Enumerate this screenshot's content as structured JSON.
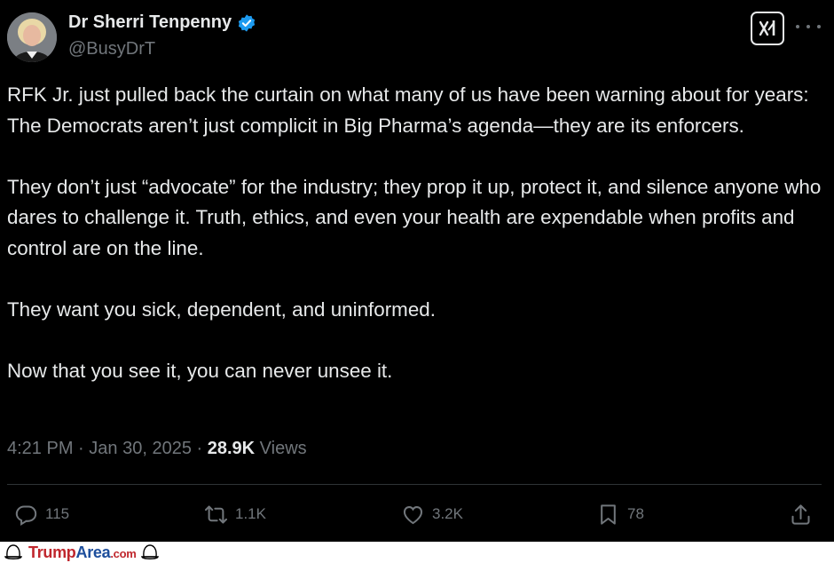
{
  "author": {
    "display_name": "Dr Sherri Tenpenny",
    "handle": "@BusyDrT",
    "verified": true
  },
  "tweet": {
    "paragraphs": [
      "RFK Jr. just pulled back the curtain on what many of us have been warning about for years: The Democrats aren’t just complicit in Big Pharma’s agenda—they are its enforcers.",
      "They don’t just “advocate” for the industry; they prop it up, protect it, and silence anyone who dares to challenge it. Truth, ethics, and even your health are expendable when profits and control are on the line.",
      "They want you sick, dependent, and uninformed.",
      "Now that you see it, you can never unsee it."
    ],
    "time": "4:21 PM",
    "date": "Jan 30, 2025",
    "separator": "·",
    "views_count": "28.9K",
    "views_label": "Views"
  },
  "actions": {
    "replies": "115",
    "reposts": "1.1K",
    "likes": "3.2K",
    "bookmarks": "78"
  },
  "icons": {
    "verified": "verified-badge-icon",
    "grok": "grok-icon",
    "more": "more-icon",
    "reply": "reply-icon",
    "repost": "repost-icon",
    "like": "heart-icon",
    "bookmark": "bookmark-icon",
    "share": "share-icon"
  },
  "colors": {
    "background": "#000000",
    "text": "#e7e9ea",
    "muted": "#71767b",
    "verified": "#1d9bf0",
    "brand_red": "#c0272d",
    "brand_blue": "#1d4e9c"
  },
  "watermark": {
    "part1": "Trump",
    "part2": "Area",
    "part3": ".com"
  }
}
